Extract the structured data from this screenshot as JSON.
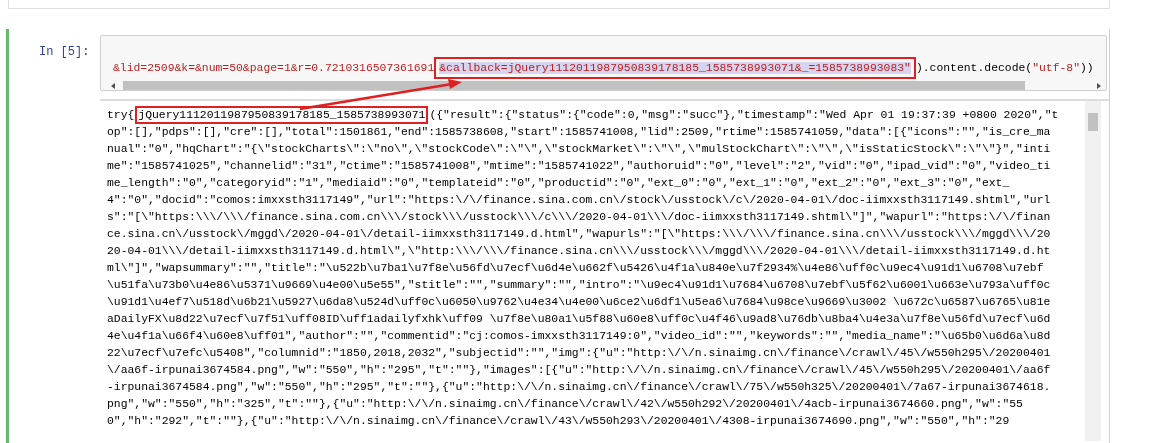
{
  "cell": {
    "prompt": "In [5]:",
    "input_segments": [
      {
        "text": "&lid=2509&k=&num=50&page=1&r=0.7210316507361691",
        "kind": "string",
        "boxed": false
      },
      {
        "text": "&callback=jQuery1112011987950839178185_1585738993071&_=1585738993083\"",
        "kind": "string",
        "boxed": true
      },
      {
        "text": ").content.decode(",
        "kind": "plain",
        "boxed": false
      },
      {
        "text": "\"utf-8\"",
        "kind": "string",
        "boxed": false
      },
      {
        "text": "))",
        "kind": "plain",
        "boxed": false
      }
    ],
    "output_first_line": [
      {
        "text": "try{",
        "boxed": false
      },
      {
        "text": "jQuery1112011987950839178185_1585738993071",
        "boxed": true
      },
      {
        "text": "({\"result\":{\"status\":{\"code\":0,\"msg\":\"succ\"},\"timestamp\":\"Wed Apr 01 19:37:39 +0800 2020\",\"t",
        "boxed": false
      }
    ],
    "output_lines": [
      "op\":[],\"pdps\":[],\"cre\":[],\"total\":1501861,\"end\":1585738608,\"start\":1585741008,\"lid\":2509,\"rtime\":1585741059,\"data\":[{\"icons\":\"\",\"is_cre_ma",
      "nual\":\"0\",\"hqChart\":\"{\\\"stockCharts\\\":\\\"no\\\",\\\"stockCode\\\":\\\"\\\",\\\"stockMarket\\\":\\\"\\\",\\\"mulStockChart\\\":\\\"\\\",\\\"isStaticStock\\\":\\\"\\\"}\",\"inti",
      "me\":\"1585741025\",\"channelid\":\"31\",\"ctime\":\"1585741008\",\"mtime\":\"1585741022\",\"authoruid\":\"0\",\"level\":\"2\",\"vid\":\"0\",\"ipad_vid\":\"0\",\"video_ti",
      "me_length\":\"0\",\"categoryid\":\"1\",\"mediaid\":\"0\",\"templateid\":\"0\",\"productid\":\"0\",\"ext_0\":\"0\",\"ext_1\":\"0\",\"ext_2\":\"0\",\"ext_3\":\"0\",\"ext_",
      "4\":\"0\",\"docid\":\"comos:imxxsth3117149\",\"url\":\"https:\\/\\/finance.sina.com.cn\\/stock\\/usstock\\/c\\/2020-04-01\\/doc-iimxxsth3117149.shtml\",\"url",
      "s\":\"[\\\"https:\\\\\\/\\\\\\/finance.sina.com.cn\\\\\\/stock\\\\\\/usstock\\\\\\/c\\\\\\/2020-04-01\\\\\\/doc-iimxxsth3117149.shtml\\\"]\",\"wapurl\":\"https:\\/\\/finan",
      "ce.sina.cn\\/usstock\\/mggd\\/2020-04-01\\/detail-iimxxsth3117149.d.html\",\"wapurls\":\"[\\\"https:\\\\\\/\\\\\\/finance.sina.cn\\\\\\/usstock\\\\\\/mggd\\\\\\/20",
      "20-04-01\\\\\\/detail-iimxxsth3117149.d.html\\\",\\\"http:\\\\\\/\\\\\\/finance.sina.cn\\\\\\/usstock\\\\\\/mggd\\\\\\/2020-04-01\\\\\\/detail-iimxxsth3117149.d.ht",
      "ml\\\"]\",\"wapsummary\":\"\",\"title\":\"\\u522b\\u7ba1\\u7f8e\\u56fd\\u7ecf\\u6d4e\\u662f\\u5426\\u4f1a\\u840e\\u7f2934%\\u4e86\\uff0c\\u9ec4\\u91d1\\u6708\\u7ebf",
      "\\u51fa\\u73b0\\u4e86\\u5371\\u9669\\u4e00\\u5e55\",\"stitle\":\"\",\"summary\":\"\",\"intro\":\"\\u9ec4\\u91d1\\u7684\\u6708\\u7ebf\\u5f62\\u6001\\u663e\\u793a\\uff0c",
      "\\u91d1\\u4ef7\\u518d\\u6b21\\u5927\\u6da8\\u524d\\uff0c\\u6050\\u9762\\u4e34\\u4e00\\u6ce2\\u6df1\\u5ea6\\u7684\\u98ce\\u9669\\u3002 \\u672c\\u6587\\u6765\\u81e",
      "aDailyFX\\u8d22\\u7ecf\\u7f51\\uff08ID\\uff1adailyfxhk\\uff09 \\u7f8e\\u80a1\\u5f88\\u60e8\\uff0c\\u4f46\\u9ad8\\u76db\\u8ba4\\u4e3a\\u7f8e\\u56fd\\u7ecf\\u6d",
      "4e\\u4f1a\\u66f4\\u60e8\\uff01\",\"author\":\"\",\"commentid\":\"cj:comos-imxxsth3117149:0\",\"video_id\":\"\",\"keywords\":\"\",\"media_name\":\"\\u65b0\\u6d6a\\u8d",
      "22\\u7ecf\\u7efc\\u5408\",\"columnid\":\"1850,2018,2032\",\"subjectid\":\"\",\"img\":{\"u\":\"http:\\/\\/n.sinaimg.cn\\/finance\\/crawl\\/45\\/w550h295\\/20200401",
      "\\/aa6f-irpunai3674584.png\",\"w\":\"550\",\"h\":\"295\",\"t\":\"\"},\"images\":[{\"u\":\"http:\\/\\/n.sinaimg.cn\\/finance\\/crawl\\/45\\/w550h295\\/20200401\\/aa6f",
      "-irpunai3674584.png\",\"w\":\"550\",\"h\":\"295\",\"t\":\"\"},{\"u\":\"http:\\/\\/n.sinaimg.cn\\/finance\\/crawl\\/75\\/w550h325\\/20200401\\/7a67-irpunai3674618.",
      "png\",\"w\":\"550\",\"h\":\"325\",\"t\":\"\"},{\"u\":\"http:\\/\\/n.sinaimg.cn\\/finance\\/crawl\\/42\\/w550h292\\/20200401\\/4acb-irpunai3674660.png\",\"w\":\"55",
      "0\",\"h\":\"292\",\"t\":\"\"},{\"u\":\"http:\\/\\/n.sinaimg.cn\\/finance\\/crawl\\/43\\/w550h293\\/20200401\\/4308-irpunai3674690.png\",\"w\":\"550\",\"h\":\"29"
    ]
  }
}
